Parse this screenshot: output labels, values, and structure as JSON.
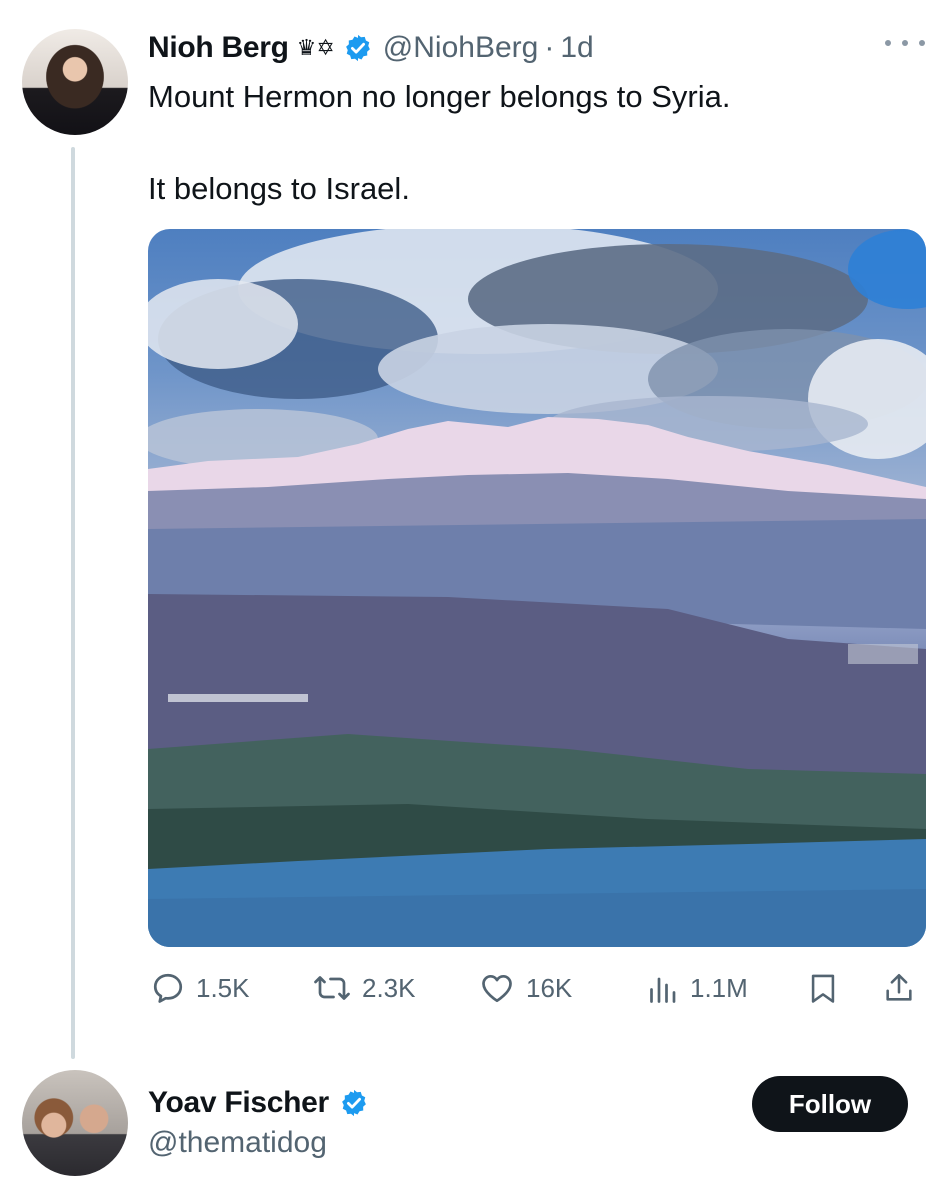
{
  "tweet": {
    "author_name": "Nioh Berg",
    "author_emoji": "♛✡",
    "handle": "@NiohBerg",
    "separator": "·",
    "time": "1d",
    "text_line1": "Mount Hermon no longer belongs to Syria.",
    "text_line2": "It belongs to Israel.",
    "stats": {
      "replies": "1.5K",
      "reposts": "2.3K",
      "likes": "16K",
      "views": "1.1M"
    }
  },
  "suggested_user": {
    "name": "Yoav Fischer",
    "handle": "@thematidog",
    "follow_label": "Follow"
  },
  "colors": {
    "verified": "#1d9bf0",
    "text": "#0f1419",
    "muted": "#536471",
    "follow_bg": "#0f1419"
  }
}
